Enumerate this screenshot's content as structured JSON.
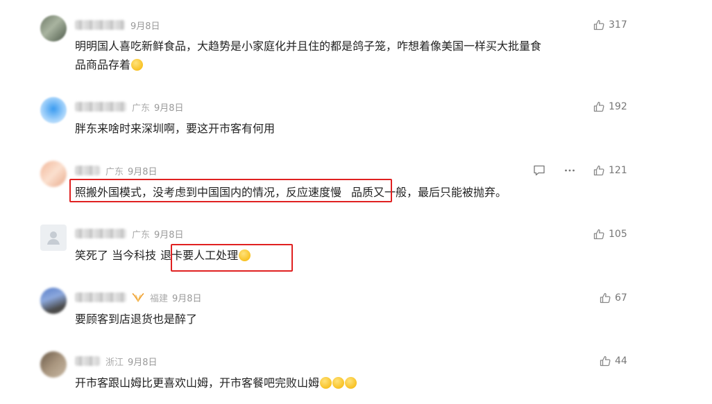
{
  "comments": [
    {
      "location": "",
      "date": "9月8日",
      "likes": "317",
      "text1": "明明国人喜吃新鲜食品，大趋势是小家庭化并且住的都是鸽子笼，咋想着像美国一样买大批量食",
      "text2": "品商品存着"
    },
    {
      "location": "广东",
      "date": "9月8日",
      "likes": "192",
      "text": "胖东来啥时来深圳啊，要这开市客有何用"
    },
    {
      "location": "广东",
      "date": "9月8日",
      "likes": "121",
      "text_highlighted": "照搬外国模式，没考虑到中国国内的情况，反应速度慢",
      "text_rest": "品质又一般，最后只能被抛弃。"
    },
    {
      "location": "广东",
      "date": "9月8日",
      "likes": "105",
      "text_plain": "笑死了 当今科技",
      "text_highlighted": "退卡要人工处理"
    },
    {
      "location": "福建",
      "date": "9月8日",
      "likes": "67",
      "text": "要顾客到店退货也是醉了"
    },
    {
      "location": "浙江",
      "date": "9月8日",
      "likes": "44",
      "text": "开市客跟山姆比更喜欢山姆，开市客餐吧完败山姆"
    }
  ],
  "icons": {
    "like": "thumbs-up-icon",
    "reply": "comment-icon",
    "more": "more-dots-icon",
    "vip": "vip-badge-icon"
  },
  "colors": {
    "highlight_box": "#e02020",
    "meta_text": "#999999",
    "body_text": "#222222"
  }
}
